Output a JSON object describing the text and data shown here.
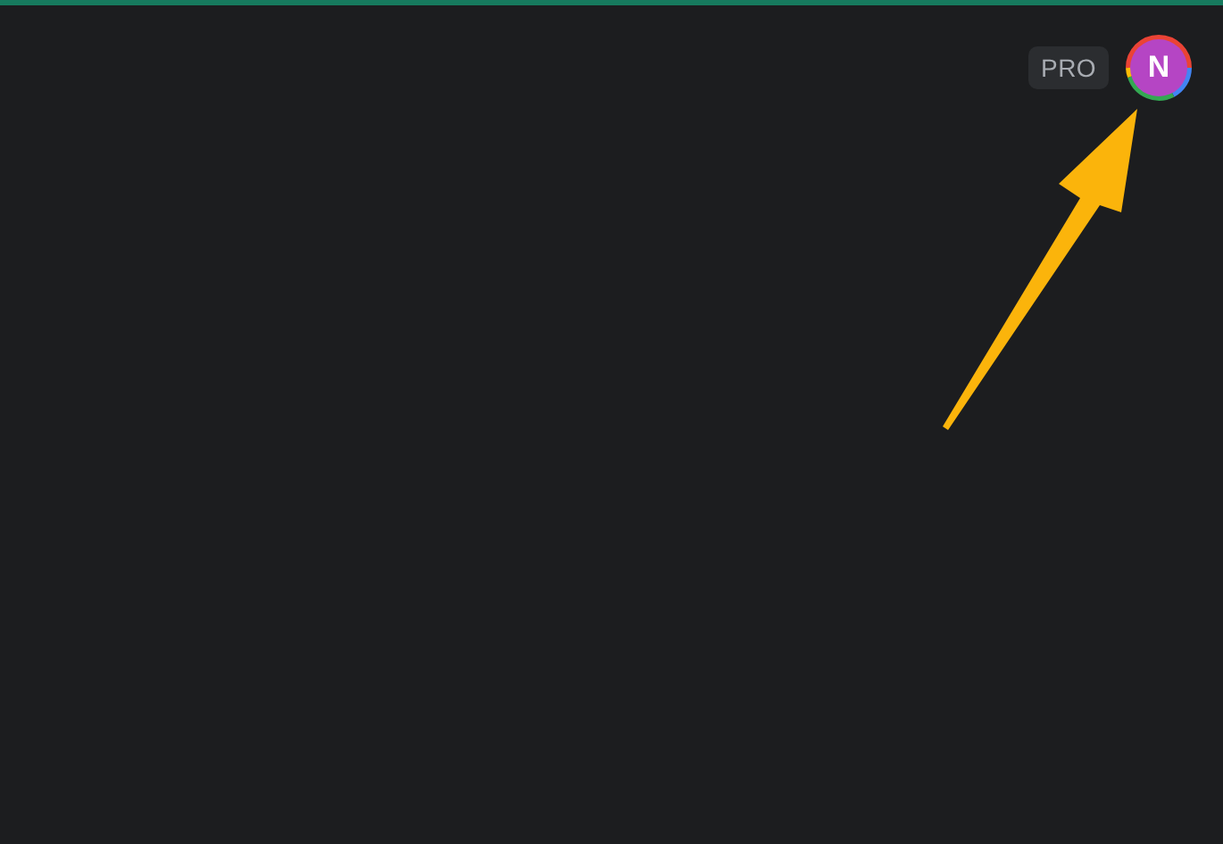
{
  "header": {
    "badge": "PRO",
    "avatar": {
      "initial": "N"
    }
  },
  "annotation": {
    "kind": "arrow"
  }
}
